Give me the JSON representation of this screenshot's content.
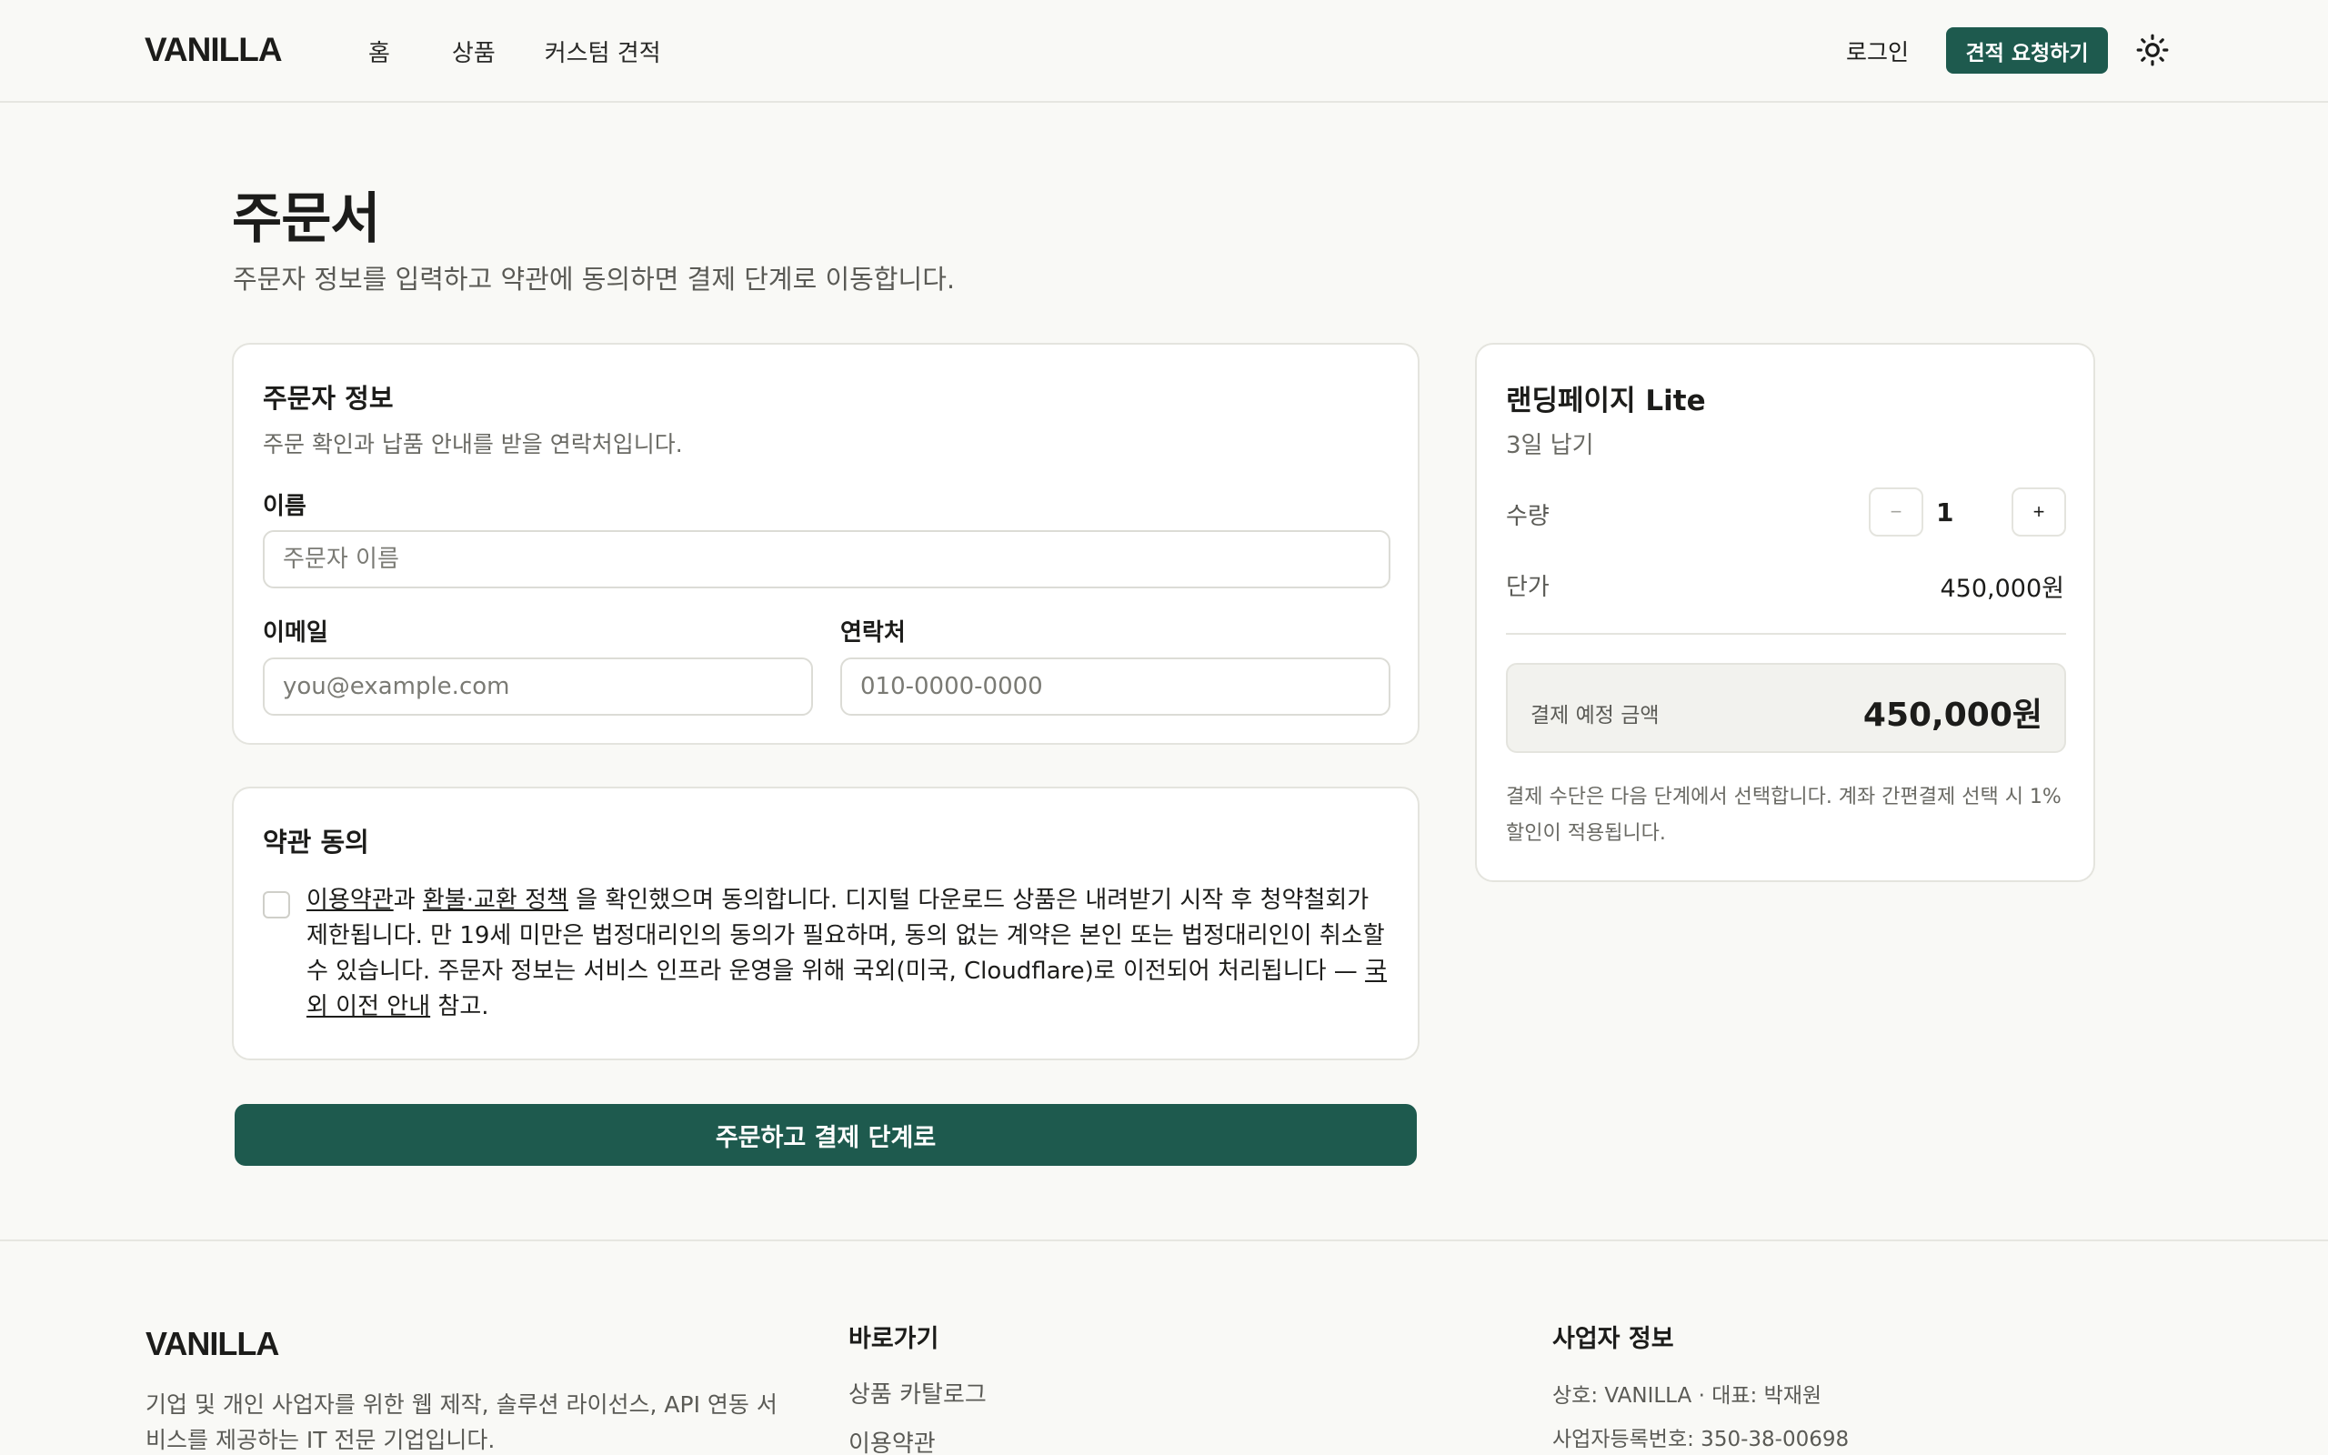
{
  "header": {
    "logo": "VANILLA",
    "nav": [
      {
        "label": "홈"
      },
      {
        "label": "상품"
      },
      {
        "label": "커스텀 견적"
      }
    ],
    "login_label": "로그인",
    "quote_button_label": "견적 요청하기",
    "theme_icon": "sun-icon"
  },
  "page": {
    "title": "주문서",
    "subtitle": "주문자 정보를 입력하고 약관에 동의하면 결제 단계로 이동합니다."
  },
  "orderer_card": {
    "title": "주문자 정보",
    "description": "주문 확인과 납품 안내를 받을 연락처입니다.",
    "name_label": "이름",
    "name_placeholder": "주문자 이름",
    "email_label": "이메일",
    "email_placeholder": "you@example.com",
    "phone_label": "연락처",
    "phone_placeholder": "010-0000-0000"
  },
  "terms_card": {
    "title": "약관 동의",
    "checked": false,
    "link_terms": "이용약관",
    "text_1": "과 ",
    "link_refund": "환불·교환 정책",
    "text_2": " 을 확인했으며 동의합니다. 디지털 다운로드 상품은 내려받기 시작 후 청약철회가 제한됩니다. 만 19세 미만은 법정대리인의 동의가 필요하며, 동의 없는 계약은 본인 또는 법정대리인이 취소할 수 있습니다. 주문자 정보는 서비스 인프라 운영을 위해 국외(미국, Cloudflare)로 이전되어 처리됩니다 — ",
    "link_transfer": "국외 이전 안내",
    "text_3": " 참고."
  },
  "submit_label": "주문하고 결제 단계로",
  "summary": {
    "product_name": "랜딩페이지 Lite",
    "delivery": "3일 납기",
    "quantity_label": "수량",
    "quantity": "1",
    "minus_label": "−",
    "plus_label": "+",
    "unit_price_label": "단가",
    "unit_price": "450,000원",
    "total_label": "결제 예정 금액",
    "total": "450,000원",
    "note": "결제 수단은 다음 단계에서 선택합니다. 계좌 간편결제 선택 시 1% 할인이 적용됩니다."
  },
  "footer": {
    "logo": "VANILLA",
    "description": "기업 및 개인 사업자를 위한 웹 제작, 솔루션 라이선스, API 연동 서비스를 제공하는 IT 전문 기업입니다.",
    "shortcuts_heading": "바로가기",
    "shortcuts": [
      {
        "label": "상품 카탈로그"
      },
      {
        "label": "이용약관"
      }
    ],
    "business_heading": "사업자 정보",
    "business_lines": [
      "상호: VANILLA · 대표: 박재원",
      "사업자등록번호: 350-38-00698"
    ]
  },
  "colors": {
    "brand": "#1e5a4e",
    "background": "#f9f9f6",
    "card": "#ffffff"
  }
}
